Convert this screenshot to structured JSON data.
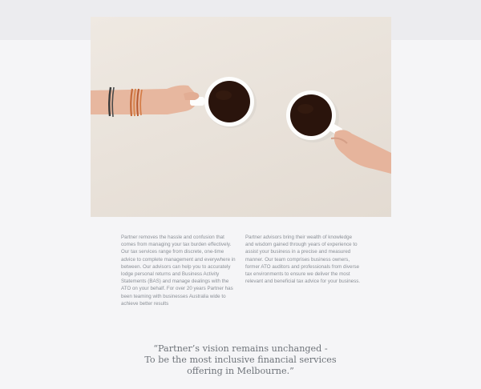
{
  "hero": {
    "image": "two-hands-with-coffee-cups"
  },
  "about": {
    "left_paragraph": "Partner removes the hassle and confusion that comes from managing your tax burden effectively. Our tax services range from discrete, one-time advice to complete management and everywhere in between. Our advisors can help you to accurately lodge personal returns and Business Activity Statements (BAS) and manage dealings with the ATO on your behalf. For over 20 years Partner has been teaming with businesses Australia wide to achieve better results",
    "right_paragraph": "Partner advisors bring their wealth of knowledge and wisdom gained through years of experience to assist your business in a precise and measured manner. Our team comprises business owners, former ATO auditors and professionals from diverse tax environments to ensure we deliver the most relevant and beneficial tax advice for your business."
  },
  "quote": {
    "line1": "“Partner’s vision remains unchanged -",
    "line2": "To be the most inclusive financial services",
    "line3": "offering in Melbourne.”"
  },
  "colors": {
    "page_background": "#f5f5f7",
    "top_band": "#ececef",
    "body_text": "#8a8f96",
    "quote_text": "#6e7379"
  }
}
